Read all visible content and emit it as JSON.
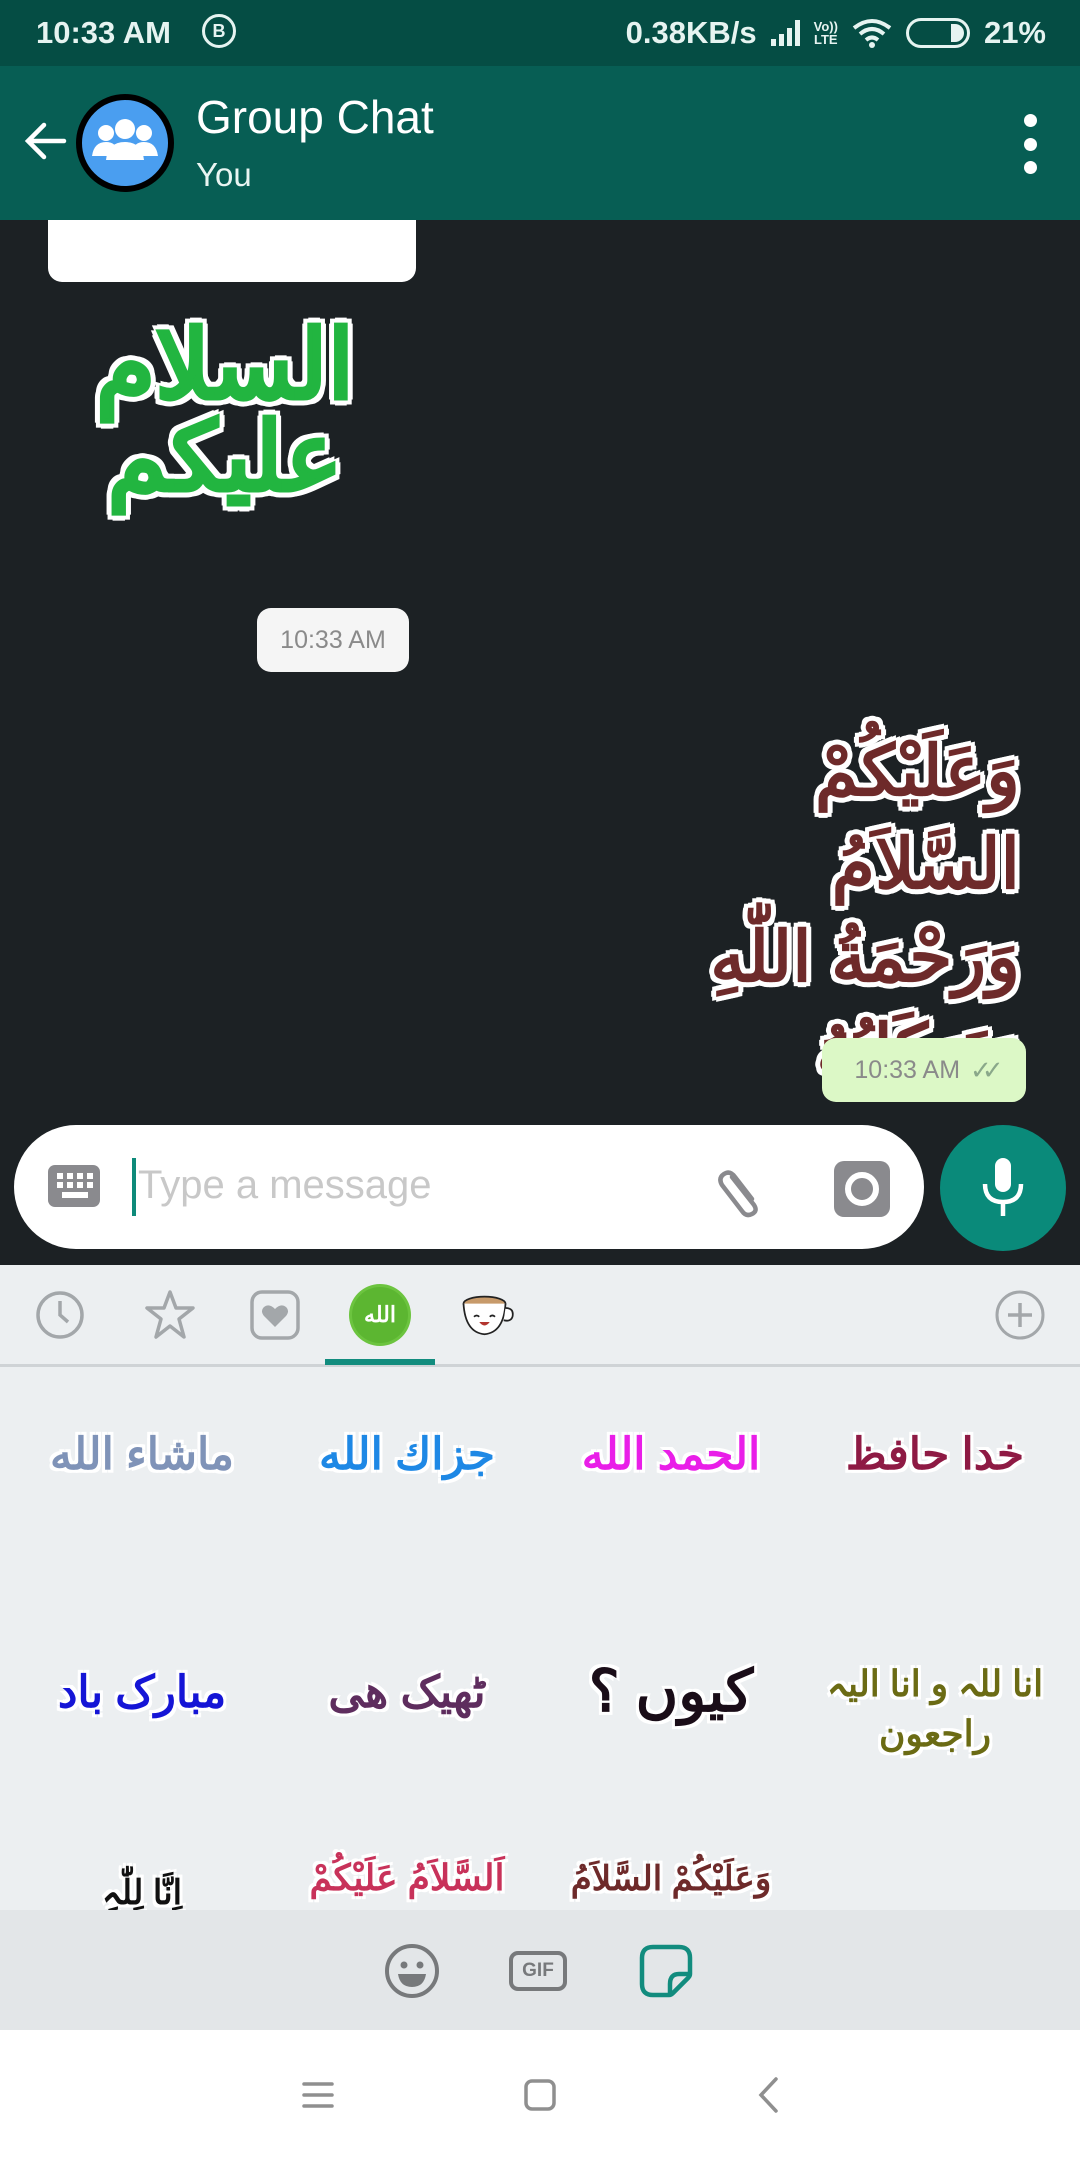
{
  "status_bar": {
    "time": "10:33 AM",
    "notification_badge": "B",
    "network_speed": "0.38KB/s",
    "volte_top": "Vo))",
    "volte_bottom": "LTE",
    "battery_percent": "21%",
    "battery_level": 0.21
  },
  "app_bar": {
    "title": "Group Chat",
    "subtitle": "You"
  },
  "chat": {
    "messages": [
      {
        "type": "sticker",
        "direction": "incoming",
        "text": "السلام عليكم",
        "color": "#22b540",
        "time": "10:33 AM"
      },
      {
        "type": "sticker",
        "direction": "outgoing",
        "lines": [
          "وَعَلَيْكُمْ السَّلاَمُ",
          "وَرَحْمَةُ اللّٰهِ",
          "وَبَرَكَاتُهُ"
        ],
        "color": "#6e2a2a",
        "time": "10:33 AM",
        "status": "read"
      }
    ]
  },
  "composer": {
    "placeholder": "Type a message",
    "value": ""
  },
  "sticker_tabs": {
    "items": [
      {
        "name": "recent",
        "icon": "clock-icon"
      },
      {
        "name": "favorites",
        "icon": "star-icon"
      },
      {
        "name": "love",
        "icon": "heart-icon"
      },
      {
        "name": "islamic",
        "icon": "allah-badge-icon",
        "label": "الله",
        "selected": true
      },
      {
        "name": "coffee",
        "icon": "coffee-cup-icon",
        "label": "☕"
      }
    ],
    "add_label": "+"
  },
  "sticker_grid": {
    "stickers": [
      {
        "text": "ماشاء الله",
        "color": "#7f93b8"
      },
      {
        "text": "جزاك الله",
        "color": "#1e88e5"
      },
      {
        "text": "الحمد الله",
        "color": "#e91ee8"
      },
      {
        "text": "خدا حافظ",
        "color": "#8e1a44"
      },
      {
        "text": "مبارک باد",
        "color": "#1515d6"
      },
      {
        "text": "ٹھیک ھی",
        "color": "#5e2d5e"
      },
      {
        "text": "کیوں ؟",
        "color": "#1a0d18"
      },
      {
        "text": "انا للہ و انا الیہ راجعون",
        "color": "#6b6b14"
      },
      {
        "text": "اِنَّا لِلّٰہِ",
        "color": "#111111"
      },
      {
        "text": "اَلسَّلاَمُ عَلَيْكُمْ",
        "color": "#c8325a"
      },
      {
        "text": "وَعَلَيْكُمْ السَّلاَمُ",
        "color": "#6e2a2a"
      }
    ]
  },
  "picker_bar": {
    "gif_label": "GIF",
    "active": "sticker"
  }
}
